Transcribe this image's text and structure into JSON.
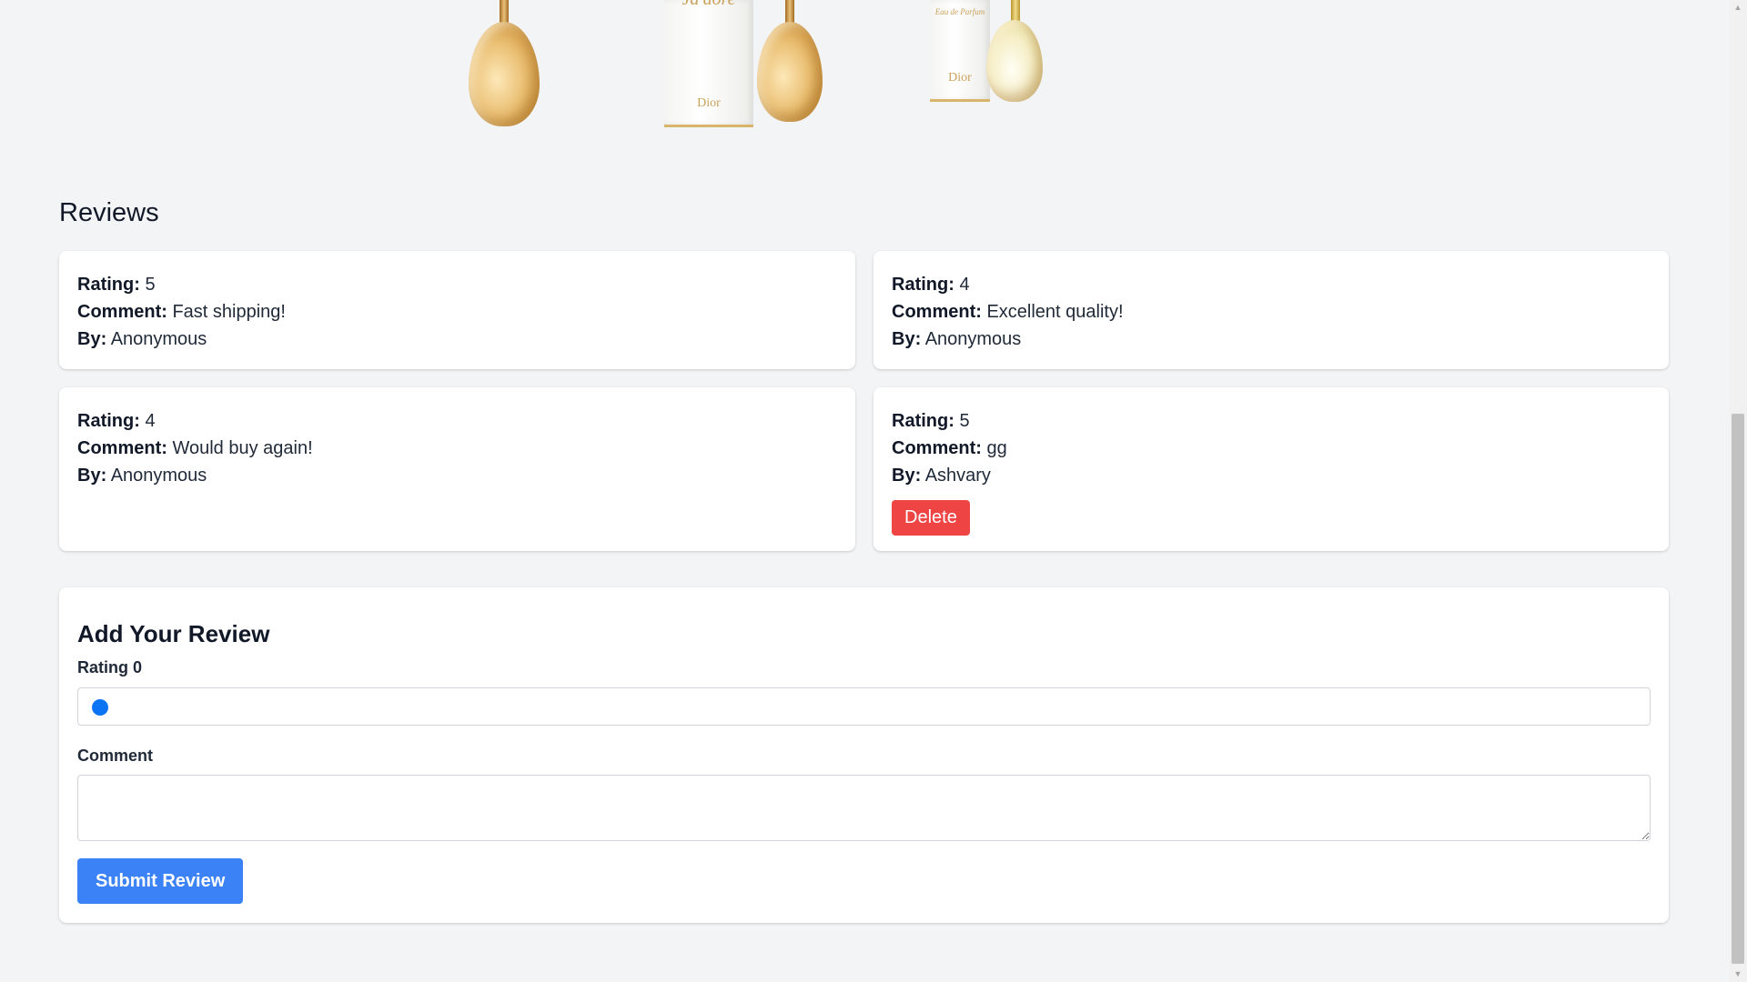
{
  "gallery": {
    "box_script": "Ja'dore",
    "box_subtitle": "Eau de Parfum",
    "brand": "Dior"
  },
  "reviews": {
    "title": "Reviews",
    "rating_label": "Rating:",
    "comment_label": "Comment:",
    "by_label": "By:",
    "items": [
      {
        "rating": "5",
        "comment": "Fast shipping!",
        "by": "Anonymous"
      },
      {
        "rating": "4",
        "comment": "Excellent quality!",
        "by": "Anonymous"
      },
      {
        "rating": "4",
        "comment": "Would buy again!",
        "by": "Anonymous"
      },
      {
        "rating": "5",
        "comment": "gg",
        "by": "Ashvary",
        "delete_label": "Delete"
      }
    ]
  },
  "form": {
    "title": "Add Your Review",
    "rating_label": "Rating 0",
    "rating_value": 0,
    "comment_label": "Comment",
    "comment_value": "",
    "submit_label": "Submit Review"
  },
  "colors": {
    "page_bg": "#f3f4f6",
    "delete": "#ef4444",
    "submit": "#3b82f6",
    "range_thumb": "#0b74f5"
  }
}
